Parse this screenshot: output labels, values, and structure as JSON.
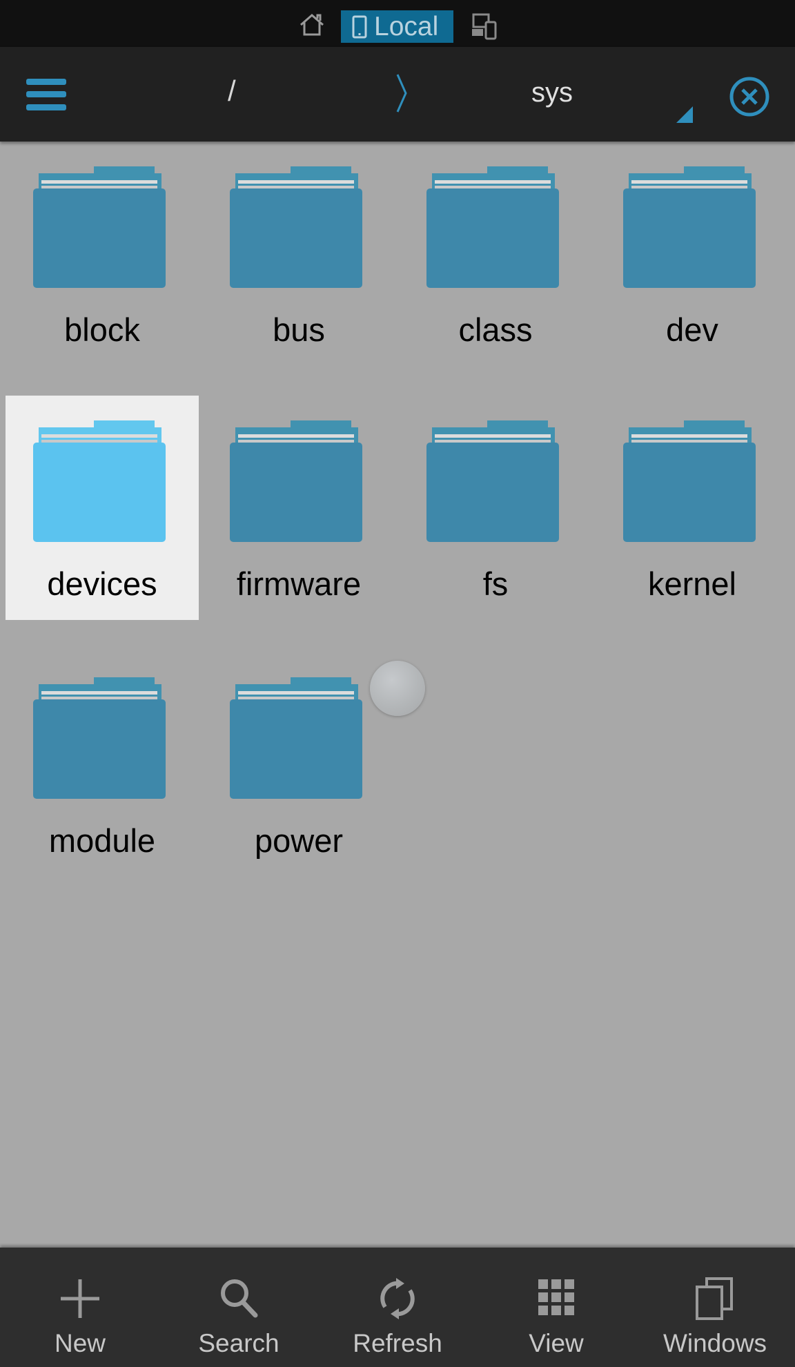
{
  "location_bar": {
    "home_icon": "home-icon",
    "active_source": "Local",
    "active_source_icon": "tablet-icon",
    "network_icon": "devices-network-icon"
  },
  "toolbar": {
    "menu_icon": "hamburger-icon",
    "breadcrumb": {
      "root": "/",
      "separator_icon": "chevron-right-icon",
      "current": "sys"
    },
    "dropdown_icon": "dropdown-triangle-icon",
    "close_icon": "close-circle-icon"
  },
  "folders": [
    {
      "name": "block",
      "selected": false
    },
    {
      "name": "bus",
      "selected": false
    },
    {
      "name": "class",
      "selected": false
    },
    {
      "name": "dev",
      "selected": false
    },
    {
      "name": "devices",
      "selected": true
    },
    {
      "name": "firmware",
      "selected": false
    },
    {
      "name": "fs",
      "selected": false
    },
    {
      "name": "kernel",
      "selected": false
    },
    {
      "name": "module",
      "selected": false
    },
    {
      "name": "power",
      "selected": false
    }
  ],
  "bottom_bar": [
    {
      "label": "New",
      "icon": "plus-icon"
    },
    {
      "label": "Search",
      "icon": "search-icon"
    },
    {
      "label": "Refresh",
      "icon": "refresh-icon"
    },
    {
      "label": "View",
      "icon": "grid-view-icon"
    },
    {
      "label": "Windows",
      "icon": "windows-icon"
    }
  ],
  "colors": {
    "accent": "#2f8fbd",
    "folder": "#3e88aa",
    "folder_selected": "#5bc3ef",
    "background": "#a8a8a8",
    "toolbar": "#212121",
    "bottom_bar": "#2e2e2e"
  }
}
